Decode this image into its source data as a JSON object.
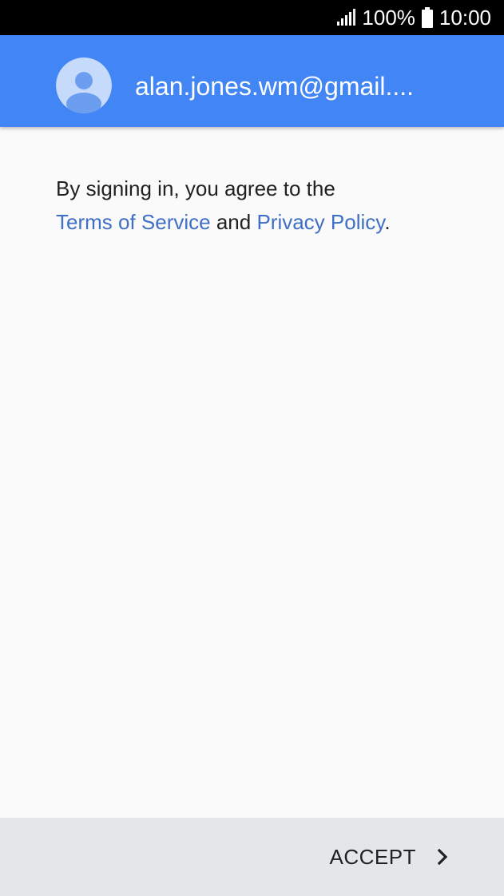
{
  "status_bar": {
    "battery_text": "100%",
    "time": "10:00",
    "signal_icon": "signal-icon",
    "battery_icon": "battery-icon"
  },
  "header": {
    "avatar_icon": "avatar-icon",
    "account_email": "alan.jones.wm@gmail...."
  },
  "content": {
    "line1": "By signing in, you agree to the",
    "terms_link": "Terms of Service",
    "and_text": " and ",
    "privacy_link": "Privacy Policy",
    "period": "."
  },
  "footer": {
    "accept_label": "ACCEPT",
    "chevron_icon": "chevron-right-icon"
  },
  "colors": {
    "header_bg": "#4285f4",
    "link": "#3f6fc7",
    "footer_bg": "#e4e7ea"
  }
}
